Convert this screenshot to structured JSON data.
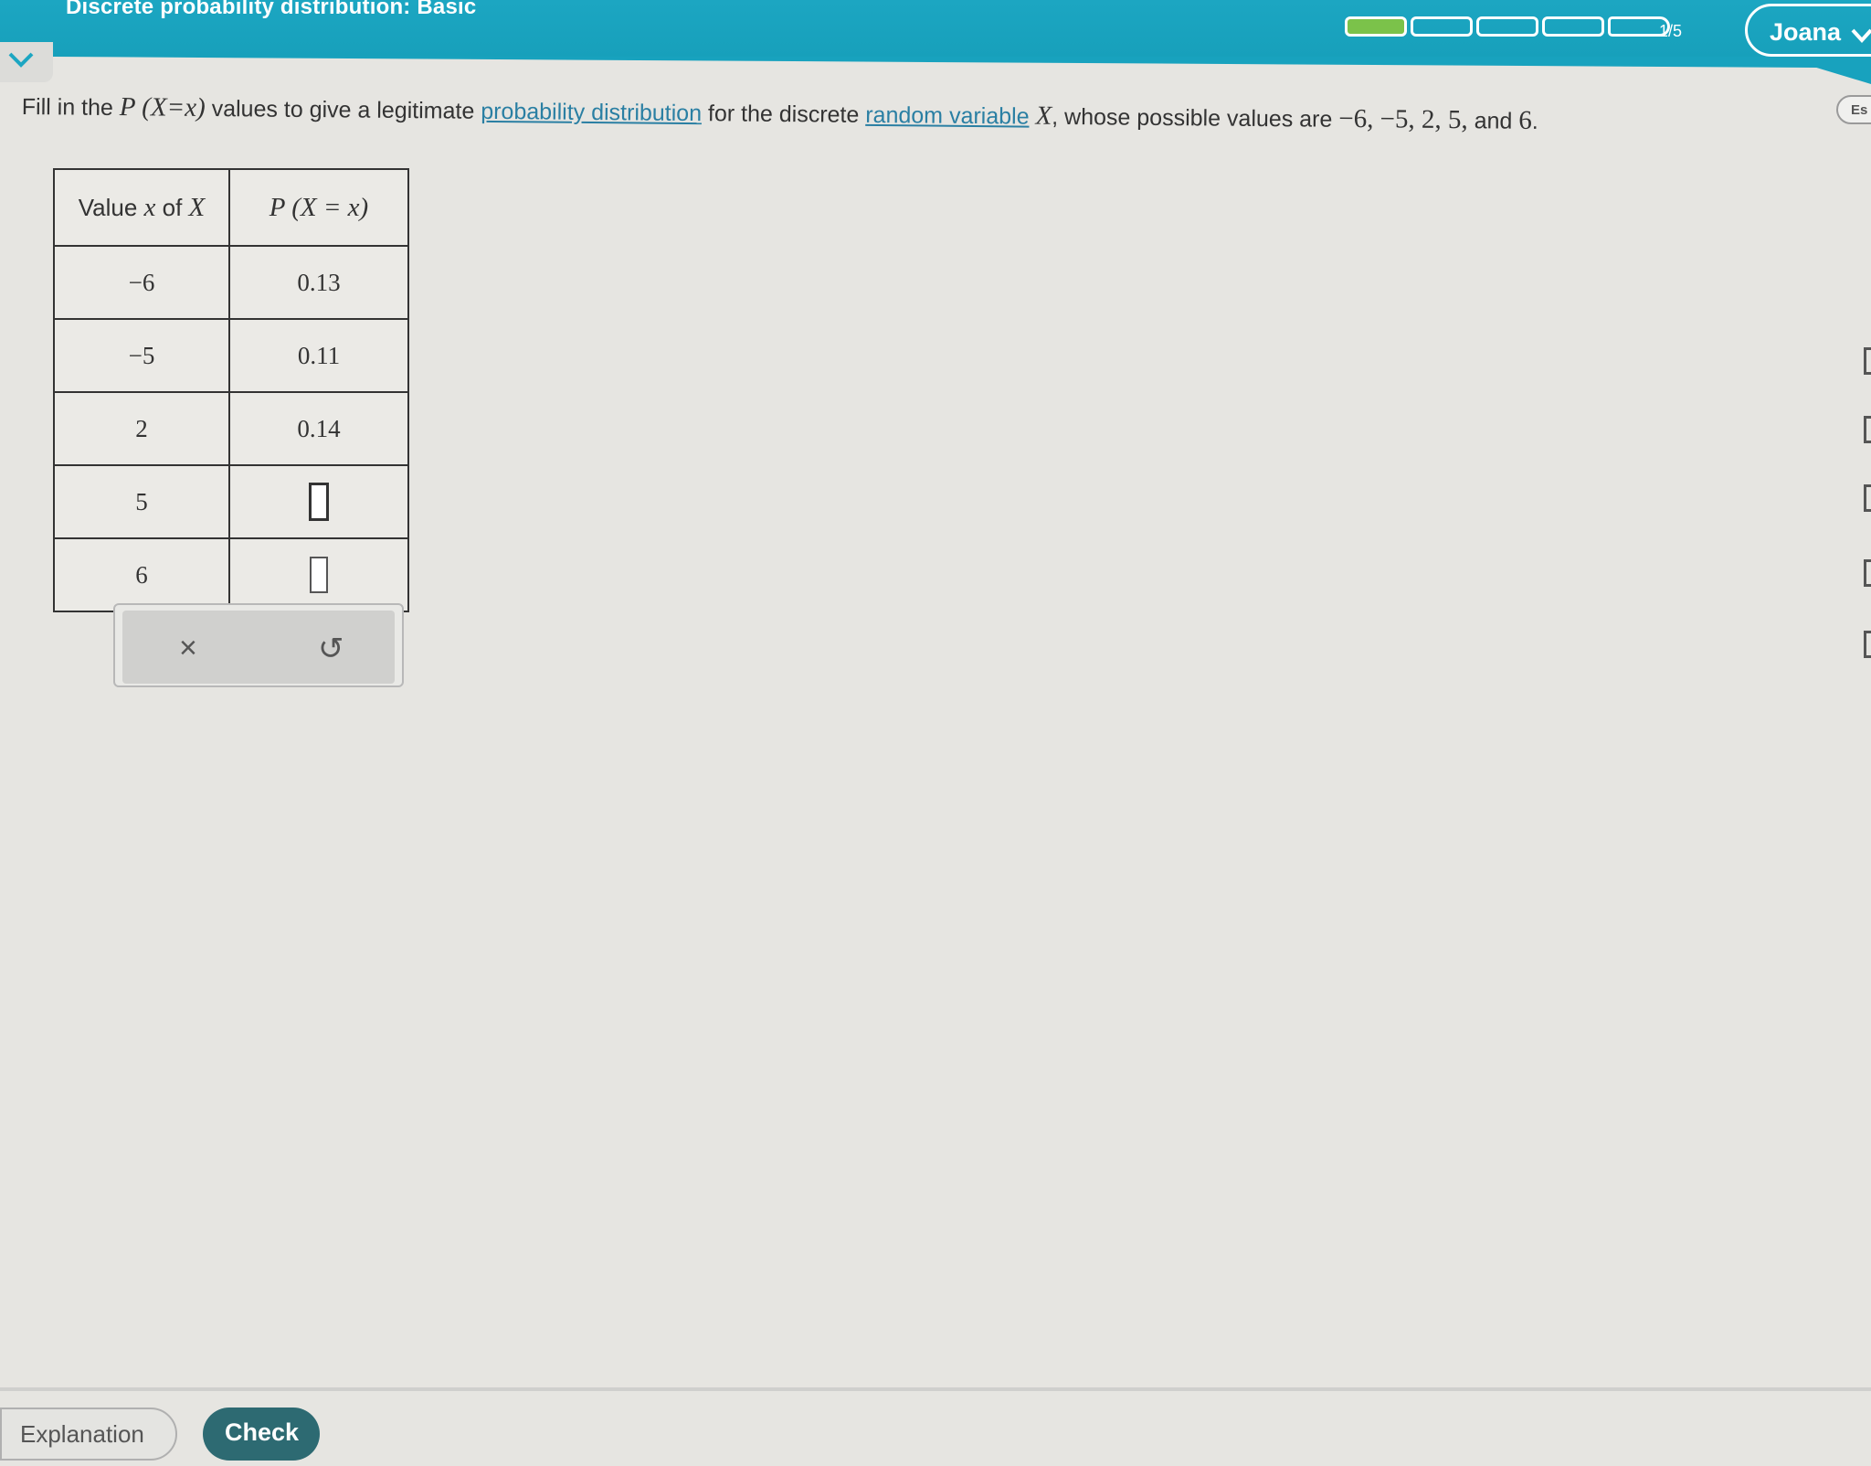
{
  "header": {
    "topic_title": "Discrete probability distribution: Basic",
    "progress": {
      "completed": 1,
      "total": 5,
      "label": "1/5"
    },
    "user_name": "Joana",
    "side_button": "Es"
  },
  "question": {
    "text_1": "Fill in the ",
    "math_1": "P (X=x)",
    "text_2": " values to give a legitimate ",
    "link_1": "probability distribution",
    "text_3": " for the discrete ",
    "link_2": "random variable",
    "text_4": " ",
    "math_2": "X",
    "text_5": ", whose possible values are ",
    "values_text": "−6, −5, 2, 5,",
    "text_6": " and ",
    "last_value": "6",
    "text_7": "."
  },
  "table": {
    "header_value_prefix": "Value ",
    "header_value_var": "x",
    "header_value_of": " of ",
    "header_value_X": "X",
    "header_prob": "P (X = x)",
    "rows": [
      {
        "x": "−6",
        "p": "0.13"
      },
      {
        "x": "−5",
        "p": "0.11"
      },
      {
        "x": "2",
        "p": "0.14"
      },
      {
        "x": "5",
        "p": ""
      },
      {
        "x": "6",
        "p": ""
      }
    ]
  },
  "toolbar": {
    "clear_symbol": "×",
    "undo_symbol": "↺"
  },
  "footer": {
    "explanation_label": "Explanation",
    "check_label": "Check"
  },
  "colors": {
    "header_teal": "#1ca6c2",
    "progress_green": "#7bc24a",
    "check_button": "#2d6a72",
    "link": "#2a7fa3"
  }
}
